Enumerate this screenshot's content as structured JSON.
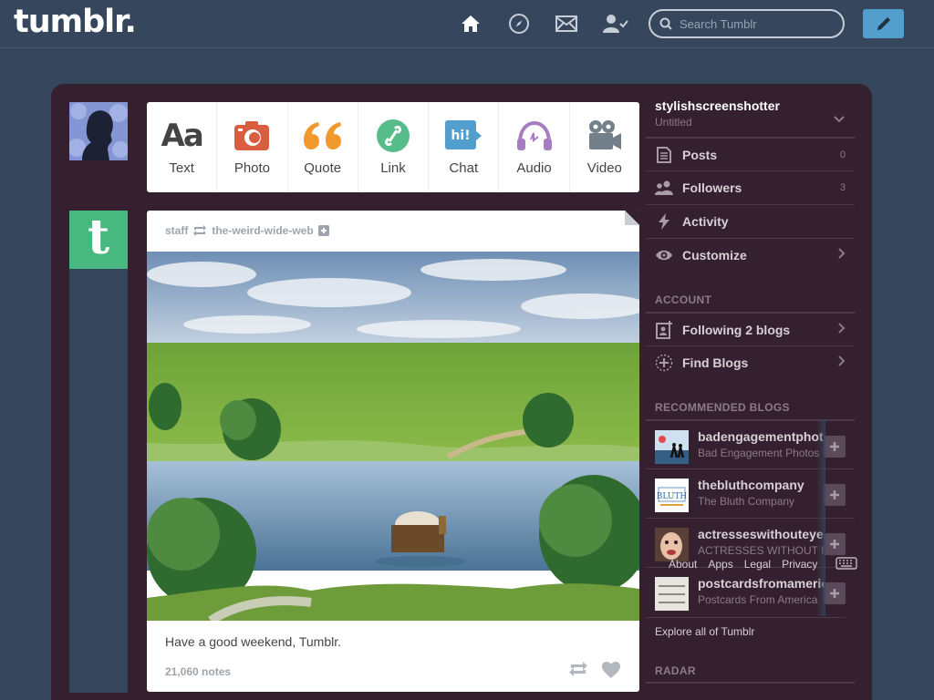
{
  "header": {
    "logo": "tumblr.",
    "search_placeholder": "Search Tumblr",
    "icons": [
      "home-icon",
      "compass-icon",
      "mail-icon",
      "account-icon",
      "pencil-icon"
    ]
  },
  "post_types": [
    {
      "label": "Text",
      "icon": "text-icon",
      "color": "#444444"
    },
    {
      "label": "Photo",
      "icon": "camera-icon",
      "color": "#d95e40"
    },
    {
      "label": "Quote",
      "icon": "quote-icon",
      "color": "#f2992e"
    },
    {
      "label": "Link",
      "icon": "link-icon",
      "color": "#56bc8a"
    },
    {
      "label": "Chat",
      "icon": "chat-icon",
      "color": "#529ecc"
    },
    {
      "label": "Audio",
      "icon": "headphones-icon",
      "color": "#a77dc2"
    },
    {
      "label": "Video",
      "icon": "video-icon",
      "color": "#748089"
    }
  ],
  "post": {
    "author": "staff",
    "reblogged_from": "the-weird-wide-web",
    "caption": "Have a good weekend, Tumblr.",
    "notes": "21,060 notes"
  },
  "sidebar": {
    "blog_name": "stylishscreenshotter",
    "blog_title": "Untitled",
    "items": [
      {
        "label": "Posts",
        "count": "0"
      },
      {
        "label": "Followers",
        "count": "3"
      },
      {
        "label": "Activity",
        "count": ""
      },
      {
        "label": "Customize",
        "count": ""
      }
    ],
    "account_heading": "ACCOUNT",
    "account_items": [
      {
        "label": "Following 2 blogs"
      },
      {
        "label": "Find Blogs"
      }
    ],
    "recommended_heading": "RECOMMENDED BLOGS",
    "recommended": [
      {
        "name": "badengagementphotos",
        "title": "Bad Engagement Photos"
      },
      {
        "name": "thebluthcompany",
        "title": "The Bluth Company"
      },
      {
        "name": "actresseswithouteyebrows",
        "title": "ACTRESSES WITHOUT EYEBROWS"
      },
      {
        "name": "postcardsfromamerica",
        "title": "Postcards From America"
      }
    ],
    "footer_links": [
      "About",
      "Apps",
      "Legal",
      "Privacy"
    ],
    "explore": "Explore all of Tumblr",
    "radar_heading": "RADAR"
  },
  "colors": {
    "background": "#36465d",
    "panel": "#35202f",
    "compose_button": "#529ecc",
    "tumblr_avatar": "#46b880"
  }
}
